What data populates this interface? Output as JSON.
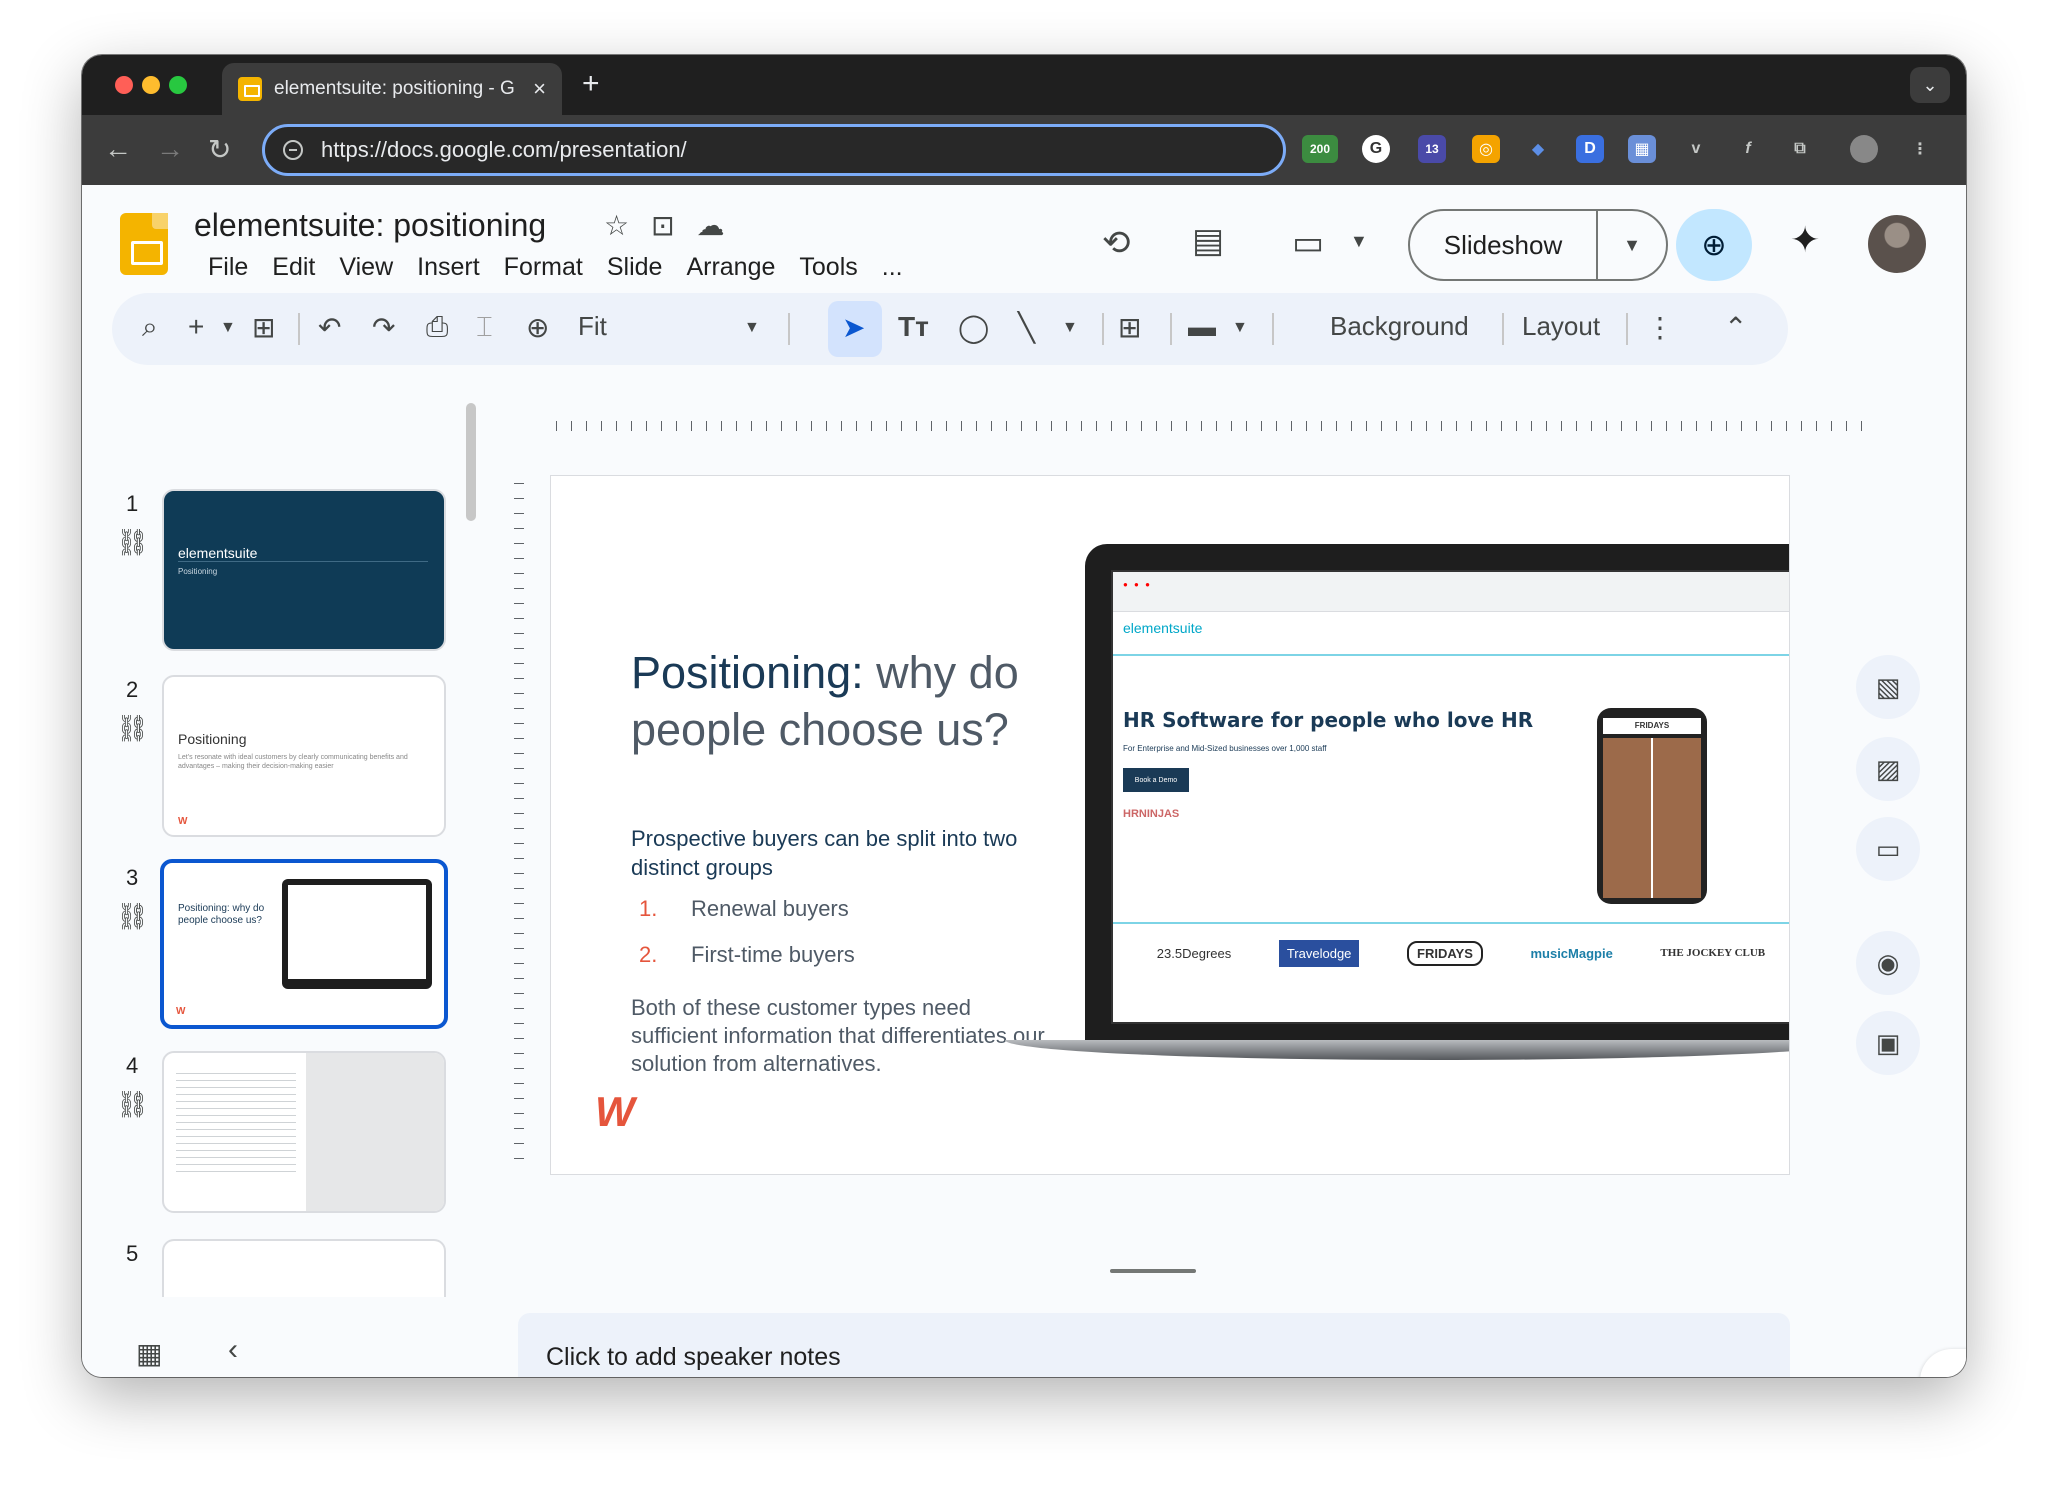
{
  "browser": {
    "tab_title": "elementsuite: positioning - G",
    "tab_close": "×",
    "new_tab": "+",
    "url": "https://docs.google.com/presentation/",
    "badge_200": "200",
    "badge_13": "13"
  },
  "app": {
    "doc_title": "elementsuite: positioning",
    "menu": [
      "File",
      "Edit",
      "View",
      "Insert",
      "Format",
      "Slide",
      "Arrange",
      "Tools",
      "..."
    ],
    "slideshow_label": "Slideshow"
  },
  "toolbar": {
    "zoom": "Fit",
    "background": "Background",
    "layout": "Layout"
  },
  "filmstrip": {
    "numbers": [
      "1",
      "2",
      "3",
      "4",
      "5"
    ],
    "slide1": {
      "title": "elementsuite",
      "subtitle": "Positioning"
    },
    "slide2": {
      "title": "Positioning",
      "body": "Let's resonate with ideal customers by clearly communicating benefits and advantages – making their decision-making easier"
    },
    "slide3": {
      "title": "Positioning: why do people choose us?"
    }
  },
  "slide": {
    "title_strong": "Positioning:",
    "title_rest": " why do people choose us?",
    "intro": "Prospective buyers can be split into two distinct groups",
    "list": [
      {
        "num": "1.",
        "text": "Renewal buyers"
      },
      {
        "num": "2.",
        "text": "First-time buyers"
      }
    ],
    "outro": "Both of these customer types need sufficient information that differentiates our solution from alternatives.",
    "logo_mark": "W",
    "screen": {
      "brand": "elementsuite",
      "headline": "HR Software for people who love HR",
      "sub": "For Enterprise and Mid-Sized businesses over 1,000 staff",
      "cta": "Book a Demo",
      "hr_ninjas": "HRNINJAS",
      "phone_label": "FRIDAYS",
      "logos": [
        "23.5Degrees",
        "Travelodge",
        "FRIDAYS",
        "musicMagpie",
        "THE JOCKEY CLUB"
      ]
    }
  },
  "notes": {
    "placeholder": "Click to add speaker notes"
  }
}
